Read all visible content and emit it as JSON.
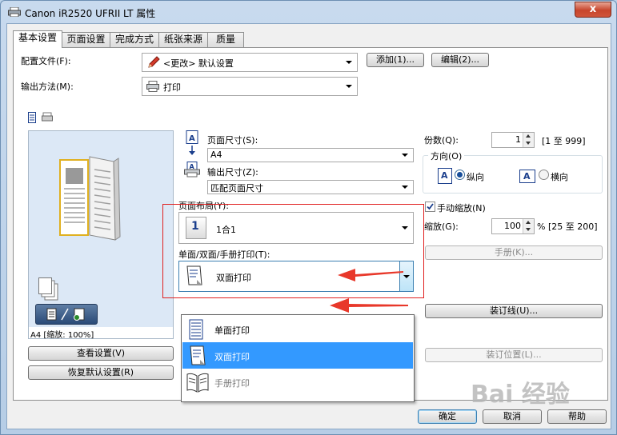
{
  "window": {
    "title": "Canon iR2520 UFRII LT 属性",
    "close_label": "x"
  },
  "tabs": [
    {
      "label": "基本设置"
    },
    {
      "label": "页面设置"
    },
    {
      "label": "完成方式"
    },
    {
      "label": "纸张来源"
    },
    {
      "label": "质量"
    }
  ],
  "profile": {
    "label": "配置文件(F):",
    "value": "<更改> 默认设置",
    "add_button": "添加(1)...",
    "edit_button": "编辑(2)..."
  },
  "output_method": {
    "label": "输出方法(M):",
    "value": "打印"
  },
  "preview": {
    "status": "A4 [缩放: 100%]",
    "view_settings_button": "查看设置(V)",
    "restore_defaults_button": "恢复默认设置(R)"
  },
  "page_size": {
    "label": "页面尺寸(S):",
    "value": "A4"
  },
  "output_size": {
    "label": "输出尺寸(Z):",
    "value": "匹配页面尺寸"
  },
  "layout": {
    "label": "页面布局(Y):",
    "value": "1合1",
    "icon_number": "1"
  },
  "duplex": {
    "label": "单面/双面/手册打印(T):",
    "value": "双面打印",
    "options": [
      "单面打印",
      "双面打印",
      "手册打印"
    ],
    "selected_index": 1
  },
  "copies": {
    "label": "份数(Q):",
    "value": "1",
    "range": "[1 至 999]"
  },
  "orientation": {
    "label": "方向(O)",
    "portrait": "纵向",
    "landscape": "横向",
    "glyph": "A"
  },
  "manual_scaling": {
    "label": "手动缩放(N)",
    "checked": true
  },
  "scaling": {
    "label": "缩放(G):",
    "value": "100",
    "range": "% [25 至 200]"
  },
  "right_buttons": {
    "booklet": "手册(K)...",
    "binding_line": "装订线(U)...",
    "binding_position": "装订位置(L)..."
  },
  "footer": {
    "ok": "确定",
    "cancel": "取消",
    "help": "帮助"
  },
  "watermark": "Bai 经验",
  "colors": {
    "selection": "#3399ff",
    "annotation_red": "#e02020"
  }
}
